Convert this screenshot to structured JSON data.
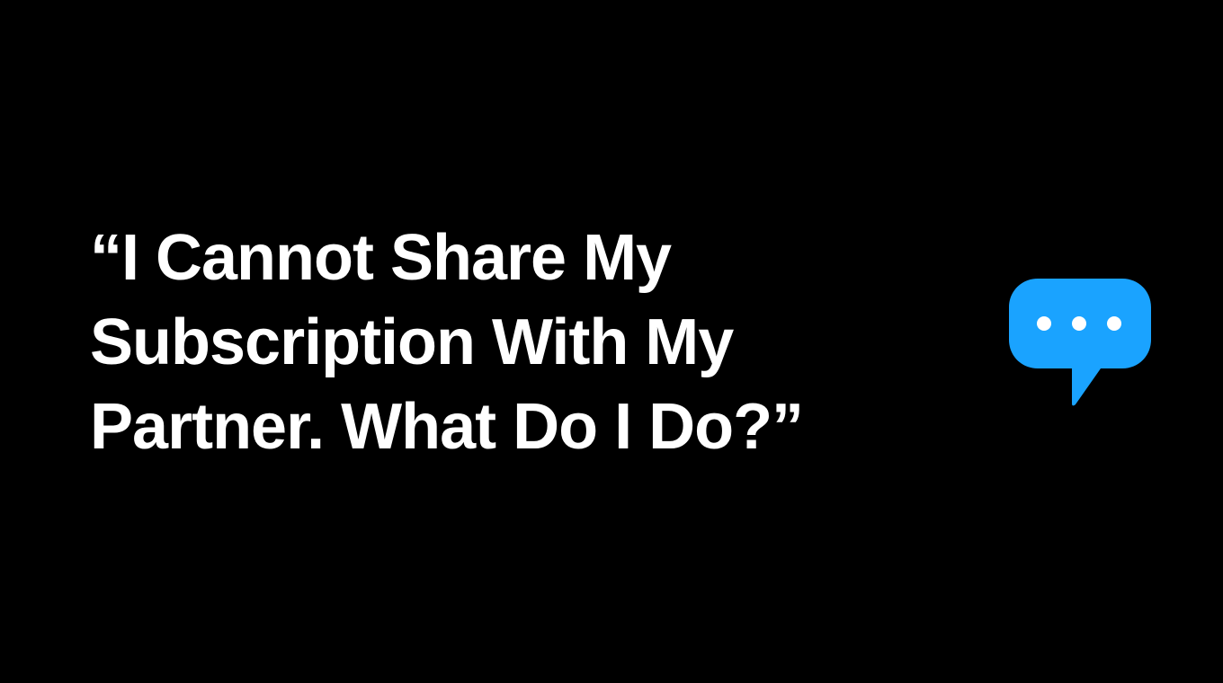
{
  "headline": {
    "lines": [
      "“I Cannot Share My",
      "Subscription With My",
      "Partner. What Do I Do?”"
    ]
  },
  "icon": {
    "name": "chat-bubble-ellipsis-icon",
    "color": "#1aa3ff",
    "dot_color": "#ffffff"
  },
  "colors": {
    "background": "#000000",
    "text": "#ffffff"
  }
}
